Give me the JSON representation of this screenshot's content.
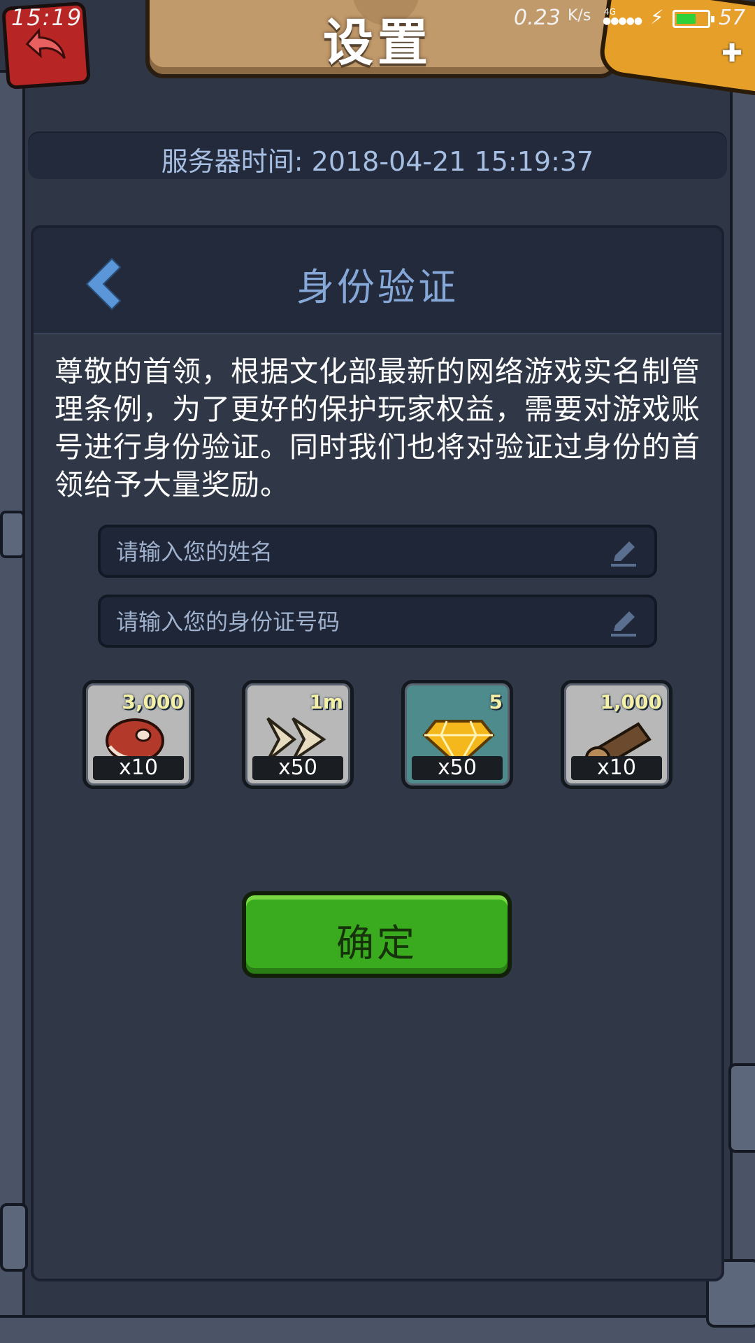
{
  "status_bar": {
    "time": "15:19",
    "speed": "0.23",
    "speed_unit": "K/s",
    "network": "4G",
    "battery_level": "57"
  },
  "header": {
    "title": "设置"
  },
  "server_time": "服务器时间: 2018-04-21 15:19:37",
  "dialog": {
    "title": "身份验证",
    "description": "尊敬的首领，根据文化部最新的网络游戏实名制管理条例，为了更好的保护玩家权益，需要对游戏账号进行身份验证。同时我们也将对验证过身份的首领给予大量奖励。",
    "name_input": {
      "placeholder": "请输入您的姓名",
      "value": ""
    },
    "id_input": {
      "placeholder": "请输入您的身份证号码",
      "value": ""
    },
    "rewards": [
      {
        "icon": "meat-icon",
        "amount": "3,000",
        "count": "x10"
      },
      {
        "icon": "speedup-arrow-icon",
        "amount": "1m",
        "count": "x50"
      },
      {
        "icon": "gem-icon",
        "amount": "5",
        "count": "x50"
      },
      {
        "icon": "wood-log-icon",
        "amount": "1,000",
        "count": "x10"
      }
    ],
    "confirm_label": "确定"
  },
  "colors": {
    "accent_blue": "#86a8d8",
    "confirm_green": "#3aaa1e",
    "header_red": "#b82525",
    "banner_tan": "#c19a6b"
  }
}
